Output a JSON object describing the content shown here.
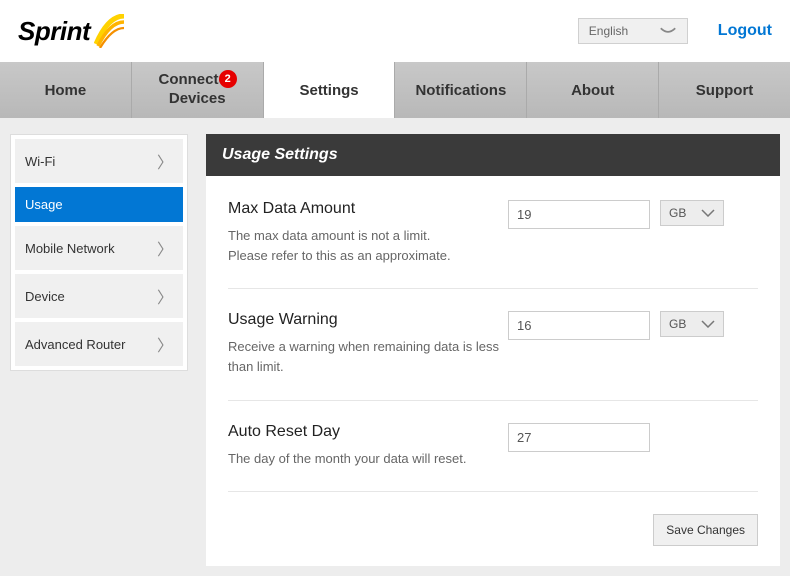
{
  "header": {
    "brand": "Sprint",
    "language": "English",
    "logout": "Logout"
  },
  "nav": {
    "items": [
      {
        "label": "Home"
      },
      {
        "label": "Connected Devices",
        "badge": 2
      },
      {
        "label": "Settings",
        "active": true
      },
      {
        "label": "Notifications"
      },
      {
        "label": "About"
      },
      {
        "label": "Support"
      }
    ]
  },
  "sidebar": {
    "items": [
      {
        "label": "Wi-Fi"
      },
      {
        "label": "Usage",
        "active": true
      },
      {
        "label": "Mobile Network"
      },
      {
        "label": "Device"
      },
      {
        "label": "Advanced Router"
      }
    ]
  },
  "content": {
    "title": "Usage Settings",
    "maxData": {
      "label": "Max Data Amount",
      "value": "19",
      "unit": "GB",
      "desc": "The max data amount is not a limit.\nPlease refer to this as an approximate."
    },
    "usageWarning": {
      "label": "Usage Warning",
      "value": "16",
      "unit": "GB",
      "desc": "Receive a warning when remaining data is less than limit."
    },
    "autoReset": {
      "label": "Auto Reset Day",
      "value": "27",
      "desc": "The day of the month your data will reset."
    },
    "save": "Save Changes"
  }
}
